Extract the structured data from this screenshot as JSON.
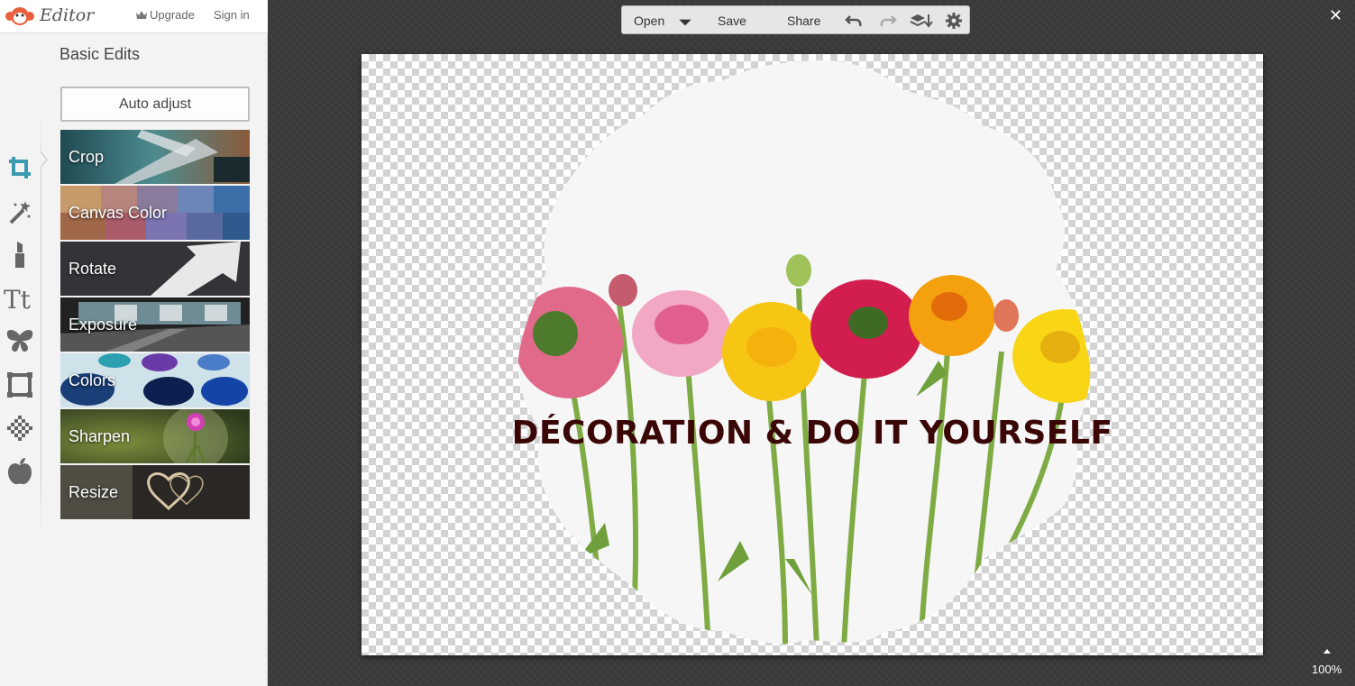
{
  "app": {
    "name": "Editor",
    "upgrade_label": "Upgrade",
    "signin_label": "Sign in",
    "logo_icon": "monkey-logo-icon",
    "accent": "#3c9bb0",
    "logo_color": "#e8603c"
  },
  "tool_rail": [
    {
      "name": "crop-tool-icon",
      "active": true
    },
    {
      "name": "magic-wand-icon",
      "active": false
    },
    {
      "name": "lipstick-icon",
      "active": false
    },
    {
      "name": "text-icon",
      "active": false
    },
    {
      "name": "butterfly-icon",
      "active": false
    },
    {
      "name": "frame-icon",
      "active": false
    },
    {
      "name": "texture-icon",
      "active": false
    },
    {
      "name": "apple-icon",
      "active": false
    }
  ],
  "panel": {
    "title": "Basic Edits",
    "auto_adjust": "Auto adjust",
    "edits": [
      {
        "label": "Crop"
      },
      {
        "label": "Canvas Color"
      },
      {
        "label": "Rotate"
      },
      {
        "label": "Exposure"
      },
      {
        "label": "Colors"
      },
      {
        "label": "Sharpen"
      },
      {
        "label": "Resize"
      }
    ]
  },
  "toolbar": {
    "open_label": "Open",
    "save_label": "Save",
    "share_label": "Share",
    "icons": [
      "chevron-down-icon",
      "undo-icon",
      "redo-icon",
      "layers-icon",
      "gear-icon"
    ]
  },
  "canvas": {
    "overlay_text": "DÉCORATION & DO IT YOURSELF",
    "overlay_color": "#3a0606"
  },
  "window": {
    "close_label": "✕",
    "zoom_level": "100%"
  }
}
